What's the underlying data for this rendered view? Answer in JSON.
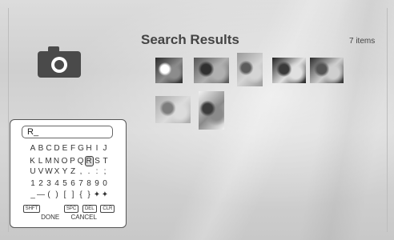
{
  "header": {
    "title": "Search Results",
    "count": "7 items"
  },
  "icons": {
    "camera": "camera-icon"
  },
  "thumbnails": [
    {
      "name": "dog-photo",
      "c1": "#2a2a2a",
      "c2": "#8c8c8c",
      "c3": "#ffffff"
    },
    {
      "name": "pattern-photo",
      "c1": "#555555",
      "c2": "#b0b0b0",
      "c3": "#303030"
    },
    {
      "name": "flowers-photo",
      "c1": "#9a9a9a",
      "c2": "#d5d5d5",
      "c3": "#5c5c5c"
    },
    {
      "name": "horse-photo",
      "c1": "#1f1f1f",
      "c2": "#e0e0e0",
      "c3": "#3a3a3a"
    },
    {
      "name": "car-photo",
      "c1": "#2b2b2b",
      "c2": "#cfcfcf",
      "c3": "#555555"
    },
    {
      "name": "blurred-photo",
      "c1": "#a9a9a9",
      "c2": "#dcdcdc",
      "c3": "#7d7d7d"
    },
    {
      "name": "landscape-photo",
      "c1": "#f2f2f2",
      "c2": "#8a8a8a",
      "c3": "#3c3c3c"
    }
  ],
  "keyboard": {
    "input_value": "R_",
    "rows": [
      [
        "A",
        "B",
        "C",
        "D",
        "E",
        "F",
        "G",
        "H",
        "I",
        "J"
      ],
      [
        "K",
        "L",
        "M",
        "N",
        "O",
        "P",
        "Q",
        "R",
        "S",
        "T"
      ],
      [
        "U",
        "V",
        "W",
        "X",
        "Y",
        "Z",
        ",",
        ".",
        ":",
        ";"
      ],
      [
        "1",
        "2",
        "3",
        "4",
        "5",
        "6",
        "7",
        "8",
        "9",
        "0"
      ],
      [
        "_",
        "—",
        "(",
        ")",
        "[",
        "]",
        "{",
        "}",
        "✦",
        "✦"
      ]
    ],
    "selected_key": "R",
    "function_keys": [
      "SHFT",
      "SPC",
      "DEL",
      "CLR"
    ],
    "done_label": "DONE",
    "cancel_label": "CANCEL"
  }
}
